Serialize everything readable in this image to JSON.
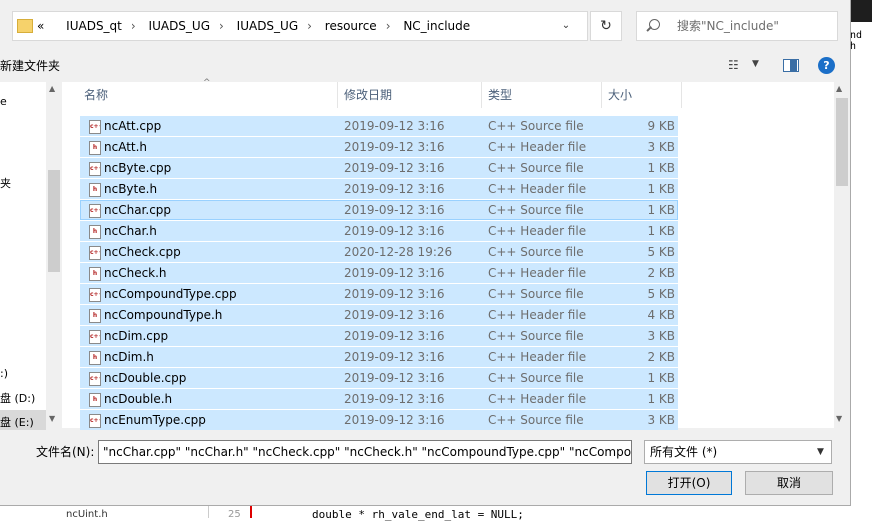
{
  "breadcrumb": [
    "IUADS_qt",
    "IUADS_UG",
    "IUADS_UG",
    "resource",
    "NC_include"
  ],
  "breadcrumb_prefix": "«",
  "search_placeholder": "搜索\"NC_include\"",
  "toolbar": {
    "new_folder": "新建文件夹"
  },
  "nav_items": [
    "e",
    "夹",
    ":)",
    "盘 (D:)",
    "盘 (E:)"
  ],
  "columns": {
    "name": "名称",
    "date": "修改日期",
    "type": "类型",
    "size": "大小"
  },
  "files": [
    {
      "name": "ncAtt.cpp",
      "date": "2019-09-12 3:16",
      "type": "C++ Source file",
      "size": "9 KB",
      "kind": "cpp"
    },
    {
      "name": "ncAtt.h",
      "date": "2019-09-12 3:16",
      "type": "C++ Header file",
      "size": "3 KB",
      "kind": "h"
    },
    {
      "name": "ncByte.cpp",
      "date": "2019-09-12 3:16",
      "type": "C++ Source file",
      "size": "1 KB",
      "kind": "cpp"
    },
    {
      "name": "ncByte.h",
      "date": "2019-09-12 3:16",
      "type": "C++ Header file",
      "size": "1 KB",
      "kind": "h"
    },
    {
      "name": "ncChar.cpp",
      "date": "2019-09-12 3:16",
      "type": "C++ Source file",
      "size": "1 KB",
      "kind": "cpp"
    },
    {
      "name": "ncChar.h",
      "date": "2019-09-12 3:16",
      "type": "C++ Header file",
      "size": "1 KB",
      "kind": "h"
    },
    {
      "name": "ncCheck.cpp",
      "date": "2020-12-28 19:26",
      "type": "C++ Source file",
      "size": "5 KB",
      "kind": "cpp"
    },
    {
      "name": "ncCheck.h",
      "date": "2019-09-12 3:16",
      "type": "C++ Header file",
      "size": "2 KB",
      "kind": "h"
    },
    {
      "name": "ncCompoundType.cpp",
      "date": "2019-09-12 3:16",
      "type": "C++ Source file",
      "size": "5 KB",
      "kind": "cpp"
    },
    {
      "name": "ncCompoundType.h",
      "date": "2019-09-12 3:16",
      "type": "C++ Header file",
      "size": "4 KB",
      "kind": "h"
    },
    {
      "name": "ncDim.cpp",
      "date": "2019-09-12 3:16",
      "type": "C++ Source file",
      "size": "3 KB",
      "kind": "cpp"
    },
    {
      "name": "ncDim.h",
      "date": "2019-09-12 3:16",
      "type": "C++ Header file",
      "size": "2 KB",
      "kind": "h"
    },
    {
      "name": "ncDouble.cpp",
      "date": "2019-09-12 3:16",
      "type": "C++ Source file",
      "size": "1 KB",
      "kind": "cpp"
    },
    {
      "name": "ncDouble.h",
      "date": "2019-09-12 3:16",
      "type": "C++ Header file",
      "size": "1 KB",
      "kind": "h"
    },
    {
      "name": "ncEnumType.cpp",
      "date": "2019-09-12 3:16",
      "type": "C++ Source file",
      "size": "3 KB",
      "kind": "cpp"
    }
  ],
  "file_name_label": "文件名(N):",
  "file_name_value": "\"ncChar.cpp\" \"ncChar.h\" \"ncCheck.cpp\" \"ncCheck.h\" \"ncCompoundType.cpp\" \"ncCompou",
  "file_type_value": "所有文件 (*)",
  "buttons": {
    "open": "打开(O)",
    "cancel": "取消"
  },
  "background": {
    "right_code": "nd h",
    "file": "ncUint.h",
    "line_number": "25",
    "code": "double * rh_vale_end_lat = NULL;"
  },
  "colors": {
    "selection": "#cce8ff",
    "focus_border": "#99d1ff",
    "accent": "#0078d7"
  }
}
